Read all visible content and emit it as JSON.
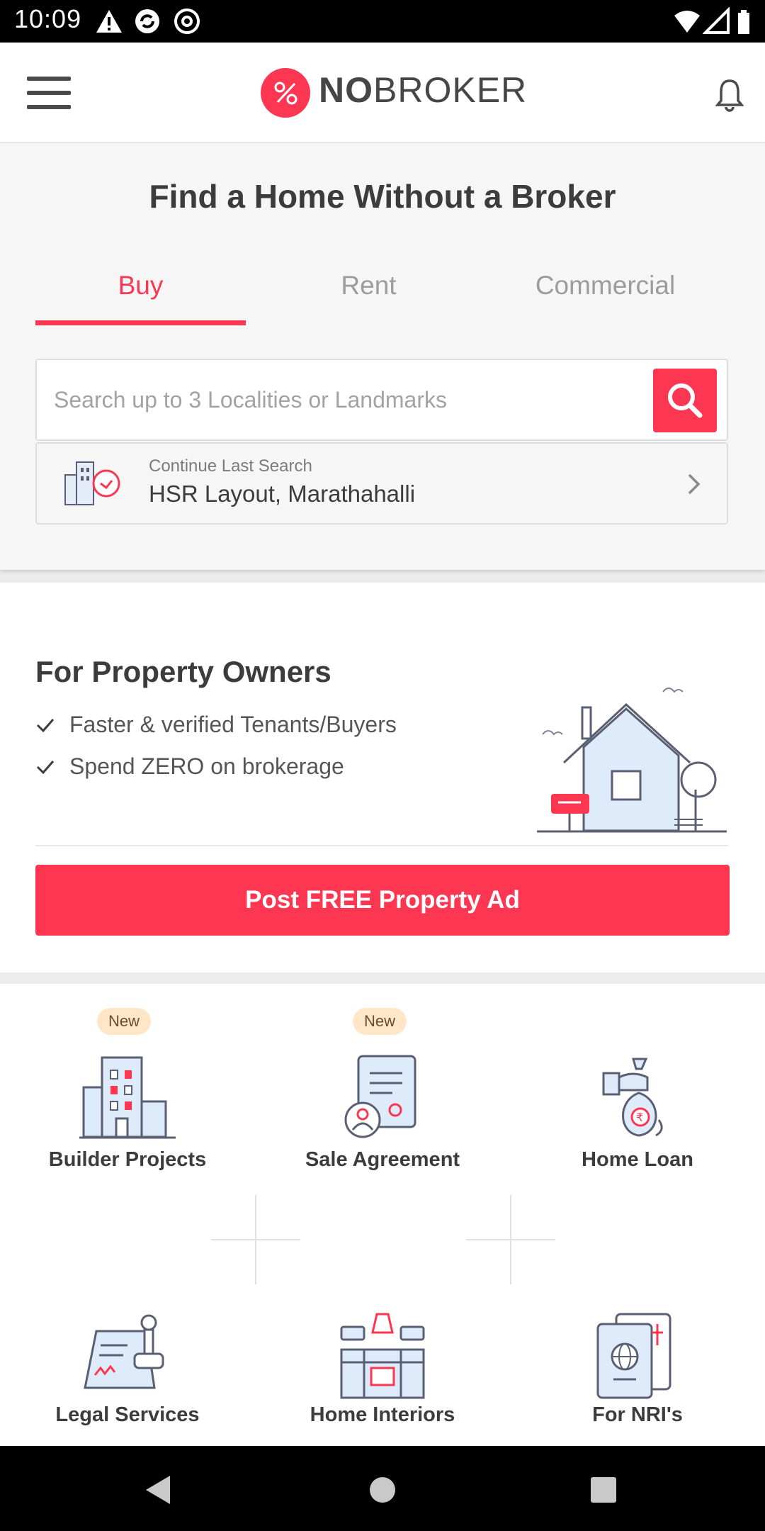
{
  "status_bar": {
    "time": "10:09"
  },
  "app_bar": {
    "logo_bold": "NO",
    "logo_light": "BROKER"
  },
  "search_section": {
    "headline": "Find a Home Without a Broker",
    "tabs": [
      {
        "label": "Buy",
        "active": true
      },
      {
        "label": "Rent",
        "active": false
      },
      {
        "label": "Commercial",
        "active": false
      }
    ],
    "search_placeholder": "Search up to 3 Localities or Landmarks",
    "last_search_label": "Continue Last Search",
    "last_search_value": "HSR Layout, Marathahalli"
  },
  "owners": {
    "title": "For Property Owners",
    "benefits": [
      "Faster & verified Tenants/Buyers",
      "Spend ZERO on brokerage"
    ],
    "cta_label": "Post FREE Property Ad"
  },
  "services": [
    {
      "label": "Builder Projects",
      "badge": "New",
      "icon": "buildings-icon"
    },
    {
      "label": "Sale Agreement",
      "badge": "New",
      "icon": "document-stamp-icon"
    },
    {
      "label": "Home Loan",
      "badge": "",
      "icon": "money-bag-icon"
    },
    {
      "label": "Legal Services",
      "badge": "",
      "icon": "legal-stamp-icon"
    },
    {
      "label": "Home Interiors",
      "badge": "",
      "icon": "kitchen-icon"
    },
    {
      "label": "For NRI's",
      "badge": "",
      "icon": "passport-icon"
    }
  ],
  "colors": {
    "brand": "#fd3752",
    "badge_bg": "#ffe6c9",
    "text_dark": "#3c3c3c",
    "text_muted": "#9c9c9c"
  }
}
